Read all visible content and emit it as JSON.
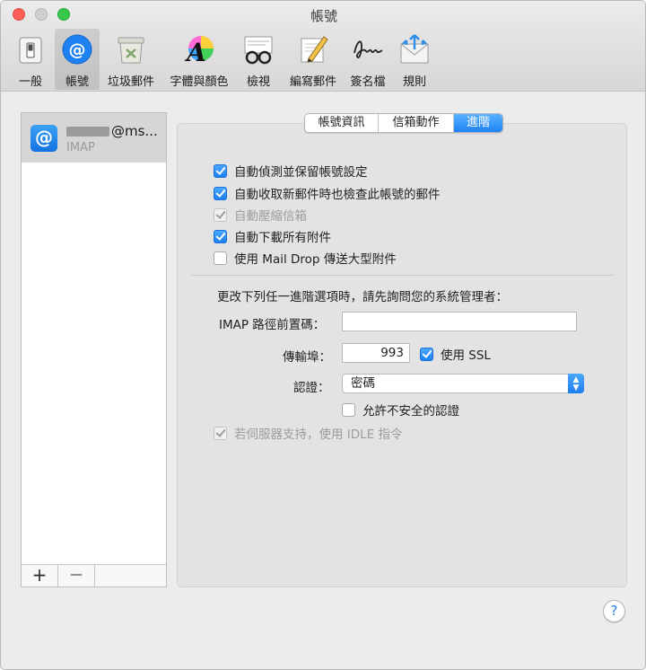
{
  "window": {
    "title": "帳號"
  },
  "toolbar": {
    "items": [
      {
        "label": "一般",
        "icon": "switch-icon"
      },
      {
        "label": "帳號",
        "icon": "at-sign-icon"
      },
      {
        "label": "垃圾郵件",
        "icon": "trash-bin-icon"
      },
      {
        "label": "字體與顏色",
        "icon": "font-color-icon"
      },
      {
        "label": "檢視",
        "icon": "glasses-icon"
      },
      {
        "label": "編寫郵件",
        "icon": "pencil-icon"
      },
      {
        "label": "簽名檔",
        "icon": "signature-icon"
      },
      {
        "label": "規則",
        "icon": "rules-envelope-icon"
      }
    ],
    "active_index": 1
  },
  "sidebar": {
    "account": {
      "name": "@ms...",
      "type": "IMAP",
      "icon": "at-sign-icon"
    },
    "add_label": "+",
    "remove_label": "—"
  },
  "tabs": [
    {
      "label": "帳號資訊"
    },
    {
      "label": "信箱動作"
    },
    {
      "label": "進階"
    }
  ],
  "active_tab": "進階",
  "options": {
    "auto_detect": {
      "label": "自動偵測並保留帳號設定",
      "checked": true,
      "enabled": true
    },
    "check_on_fetch": {
      "label": "自動收取新郵件時也檢查此帳號的郵件",
      "checked": true,
      "enabled": true
    },
    "compact_mailboxes": {
      "label": "自動壓縮信箱",
      "checked": true,
      "enabled": false
    },
    "download_attachments": {
      "label": "自動下載所有附件",
      "checked": true,
      "enabled": true
    },
    "mail_drop": {
      "label": "使用 Mail Drop 傳送大型附件",
      "checked": false,
      "enabled": true
    }
  },
  "advanced": {
    "notice": "更改下列任一進階選項時，請先詢問您的系統管理者：",
    "imap_prefix_label": "IMAP 路徑前置碼：",
    "imap_prefix_value": "",
    "port_label": "傳輸埠：",
    "port_value": "993",
    "ssl": {
      "label": "使用 SSL",
      "checked": true
    },
    "auth_label": "認證：",
    "auth_value": "密碼",
    "allow_insecure": {
      "label": "允許不安全的認證",
      "checked": false
    },
    "idle": {
      "label": "若伺服器支持，使用 IDLE 指令",
      "checked": true,
      "enabled": false
    }
  },
  "help_label": "?",
  "colors": {
    "accent": "#1e7ff2",
    "close": "#fc5f57",
    "zoom": "#35c84a"
  }
}
